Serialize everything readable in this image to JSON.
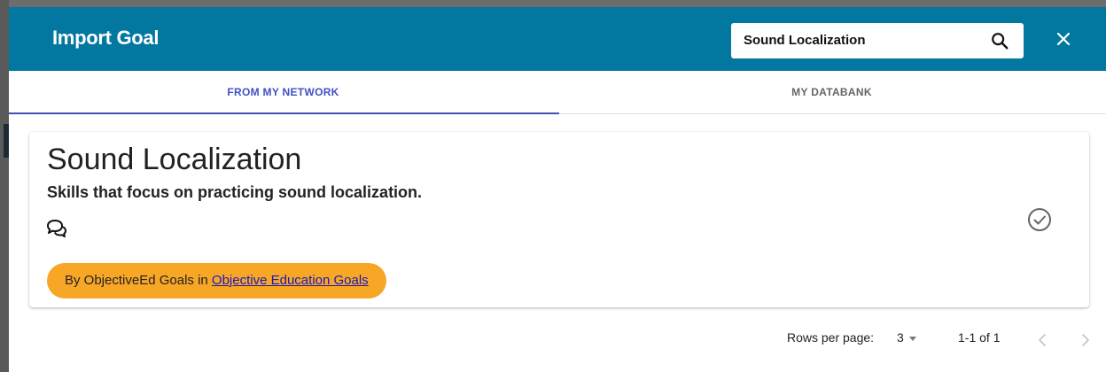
{
  "header": {
    "title": "Import Goal",
    "search_value": "Sound Localization",
    "search_icon": "search-icon",
    "close_icon": "close-icon"
  },
  "tabs": [
    {
      "label": "FROM MY NETWORK",
      "active": true
    },
    {
      "label": "MY DATABANK",
      "active": false
    }
  ],
  "goal_card": {
    "title": "Sound Localization",
    "description": "Skills that focus on practicing sound localization.",
    "comments_icon": "comments-icon",
    "select_icon": "check-circle-icon",
    "author_prefix": "By ObjectiveEd Goals in ",
    "author_link": "Objective Education Goals"
  },
  "pagination": {
    "rows_label": "Rows per page:",
    "rows_value": "3",
    "range_text": "1-1 of 1"
  },
  "colors": {
    "header_bg": "#0277a0",
    "tab_active": "#3f51b5",
    "pill_bg": "#f8a626",
    "link": "#1a1ab8"
  }
}
